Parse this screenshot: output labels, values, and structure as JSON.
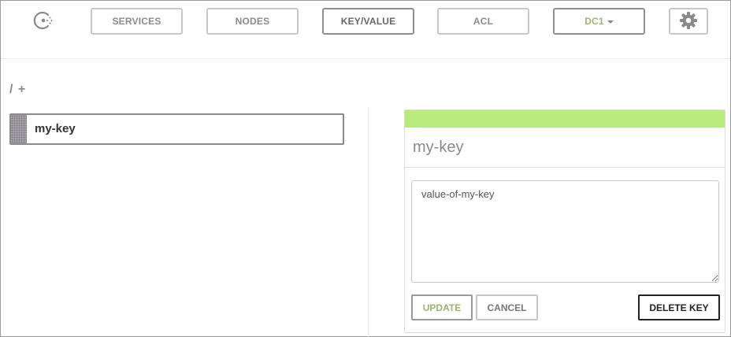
{
  "nav": {
    "logo_icon": "consul-logo-icon",
    "items": [
      {
        "label": "SERVICES"
      },
      {
        "label": "NODES"
      },
      {
        "label": "KEY/VALUE",
        "active": true
      },
      {
        "label": "ACL"
      }
    ],
    "datacenter": {
      "label": "DC1",
      "icon": "caret-down-icon"
    },
    "settings_icon": "gear-icon"
  },
  "breadcrumb": {
    "text": "/ +"
  },
  "keys": [
    {
      "label": "my-key"
    }
  ],
  "editor": {
    "status_color": "#b7ec7c",
    "title": "my-key",
    "value": "value-of-my-key",
    "update_label": "UPDATE",
    "cancel_label": "CANCEL",
    "delete_label": "DELETE KEY"
  },
  "colors": {
    "accent_green": "#9bb56e",
    "status_bar": "#b7ec7c"
  }
}
